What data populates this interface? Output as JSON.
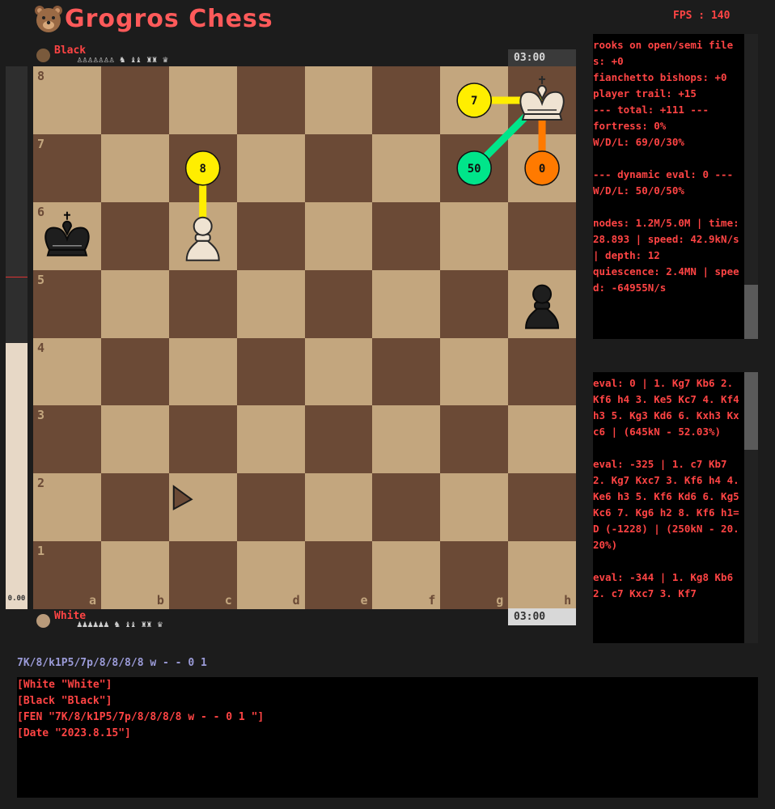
{
  "app": {
    "title": "Grogros Chess",
    "fps": "FPS : 140",
    "logo": "bear-logo-icon"
  },
  "players": {
    "black": {
      "name": "Black",
      "captured": "♙♙♙♙♙♙♙ ♞ ♝♝ ♜♜ ♛",
      "clock": "03:00"
    },
    "white": {
      "name": "White",
      "captured": "♟♟♟♟♟♟ ♞ ♝♝ ♜♜ ♛",
      "clock": "03:00"
    }
  },
  "eval_bar": {
    "score": "0.00",
    "white_fraction": 0.5
  },
  "board": {
    "files": [
      "a",
      "b",
      "c",
      "d",
      "e",
      "f",
      "g",
      "h"
    ],
    "ranks": [
      "8",
      "7",
      "6",
      "5",
      "4",
      "3",
      "2",
      "1"
    ],
    "colors": {
      "light": "#c3a67e",
      "dark": "#6b4a36"
    },
    "pieces": [
      {
        "square": "h8",
        "piece": "white-king"
      },
      {
        "square": "a6",
        "piece": "black-king"
      },
      {
        "square": "c6",
        "piece": "white-pawn"
      },
      {
        "square": "h5",
        "piece": "black-pawn"
      }
    ],
    "move_hints": [
      {
        "from": "c6",
        "to": "c7",
        "label": "8",
        "color": "#ffee00"
      },
      {
        "from": "h8",
        "to": "g8",
        "label": "7",
        "color": "#ffee00"
      },
      {
        "from": "h8",
        "to": "g7",
        "label": "50",
        "color": "#00e58a"
      },
      {
        "from": "h8",
        "to": "h7",
        "label": "0",
        "color": "#ff7a00"
      }
    ],
    "cursor": "arrow-cursor-icon"
  },
  "analysis_panel": {
    "lines": "rooks on open/semi files: +0\nfianchetto bishops: +0\nplayer trail: +15\n--- total: +111 ---\nfortress: 0%\nW/D/L: 69/0/30%\n\n--- dynamic eval: 0 ---\nW/D/L: 50/0/50%\n\nnodes: 1.2M/5.0M | time: 28.893 | speed: 42.9kN/s | depth: 12\nquiescence: 2.4MN | speed: -64955N/s"
  },
  "variations_panel": {
    "lines": "eval: 0 | 1. Kg7 Kb6 2. Kf6 h4 3. Ke5 Kc7 4. Kf4 h3 5. Kg3 Kd6 6. Kxh3 Kxc6 | (645kN - 52.03%)\n\neval: -325 | 1. c7 Kb7 2. Kg7 Kxc7 3. Kf6 h4 4. Ke6 h3 5. Kf6 Kd6 6. Kg5 Kc6 7. Kg6 h2 8. Kf6 h1=D (-1228) | (250kN - 20.20%)\n\neval: -344 | 1. Kg8 Kb6 2. c7 Kxc7 3. Kf7"
  },
  "fen": "7K/8/k1P5/7p/8/8/8/8 w - - 0 1",
  "pgn": [
    "[White \"White\"]",
    "[Black \"Black\"]",
    "[FEN \"7K/8/k1P5/7p/8/8/8/8 w - - 0 1 \"]",
    "[Date \"2023.8.15\"]"
  ]
}
